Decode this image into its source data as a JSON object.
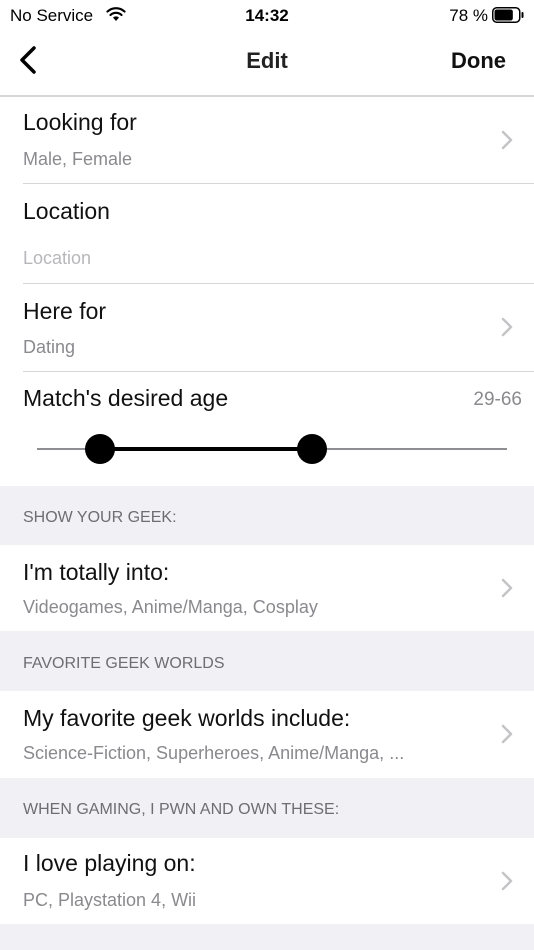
{
  "status_bar": {
    "carrier": "No Service",
    "time": "14:32",
    "battery_pct": "78 %",
    "battery_level": 0.78
  },
  "nav": {
    "title": "Edit",
    "done_label": "Done"
  },
  "rows": {
    "looking_for": {
      "title": "Looking for",
      "value": "Male, Female"
    },
    "location": {
      "title": "Location",
      "placeholder": "Location"
    },
    "here_for": {
      "title": "Here for",
      "value": "Dating"
    },
    "age": {
      "title": "Match's desired age",
      "value": "29-66",
      "min": 29,
      "max": 66
    }
  },
  "sections": {
    "geek": {
      "header": "SHOW YOUR GEEK:",
      "row": {
        "title": "I'm totally into:",
        "value": "Videogames, Anime/Manga, Cosplay"
      }
    },
    "worlds": {
      "header": "FAVORITE GEEK WORLDS",
      "row": {
        "title": "My favorite geek worlds include:",
        "value": "Science-Fiction, Superheroes, Anime/Manga, ..."
      }
    },
    "gaming": {
      "header": "WHEN GAMING, I PWN AND OWN THESE:",
      "row": {
        "title": "I love playing on:",
        "value": "PC, Playstation 4, Wii"
      }
    }
  },
  "colors": {
    "section_bg": "#f0f0f5",
    "secondary_text": "#8a8a8e",
    "separator": "#d6d6d8"
  }
}
